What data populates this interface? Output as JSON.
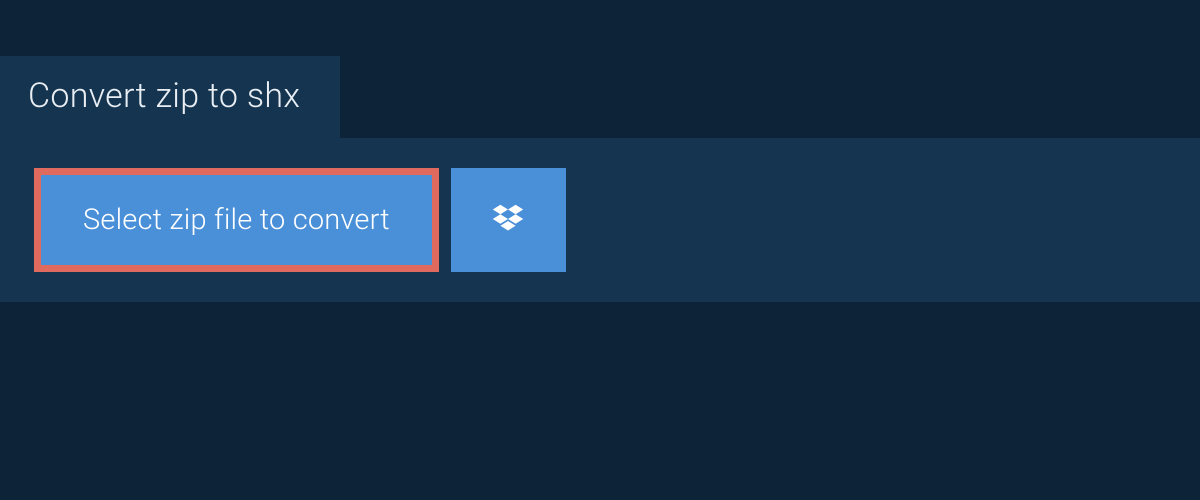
{
  "tab": {
    "title": "Convert zip to shx"
  },
  "actions": {
    "select_file_label": "Select zip file to convert"
  }
}
